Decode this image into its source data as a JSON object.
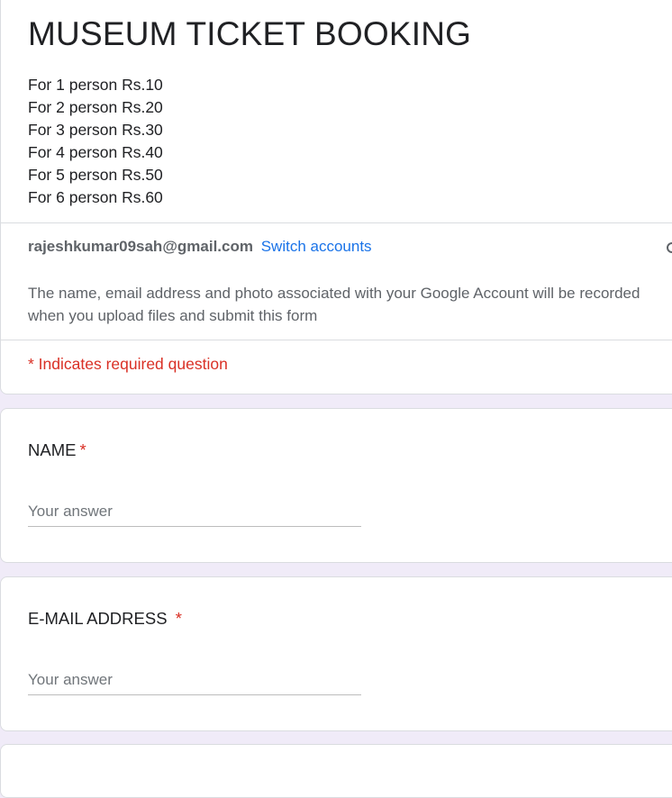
{
  "form": {
    "title": "MUSEUM TICKET BOOKING",
    "description_lines": [
      "For 1 person Rs.10",
      "For 2 person Rs.20",
      "For 3 person Rs.30",
      "For 4 person Rs.40",
      "For 5 person Rs.50",
      "For 6 person Rs.60"
    ]
  },
  "account": {
    "email": "rajeshkumar09sah@gmail.com",
    "switch_label": "Switch accounts",
    "privacy_note_lines": [
      "The name, email address and photo associated with your Google Account will be recorded",
      "when you upload files and submit this form"
    ],
    "status_icon": "cloud-status-icon"
  },
  "required_note": "* Indicates required question",
  "questions": [
    {
      "label": "NAME",
      "required_mark": "*",
      "placeholder": "Your answer",
      "value": ""
    },
    {
      "label": "E-MAIL ADDRESS ",
      "required_mark": "*",
      "placeholder": "Your answer",
      "value": ""
    }
  ],
  "colors": {
    "background": "#f0ebf8",
    "card": "#ffffff",
    "link": "#1a73e8",
    "required": "#d93025",
    "secondary_text": "#5f6368"
  }
}
